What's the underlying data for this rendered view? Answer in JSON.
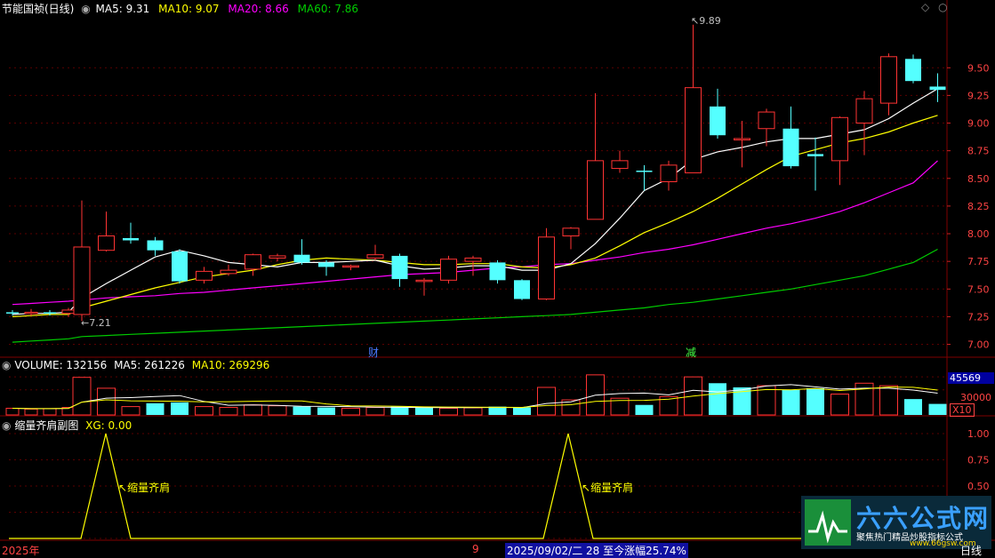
{
  "header": {
    "stock_title": "节能国祯(日线)",
    "ma5": "MA5: 9.31",
    "ma10": "MA10: 9.07",
    "ma20": "MA20: 8.66",
    "ma60": "MA60: 7.86"
  },
  "volume_header": {
    "volume": "VOLUME: 132156",
    "ma5": "MA5: 261226",
    "ma10": "MA10: 269296"
  },
  "sub_header": {
    "title": "缩量齐肩副图",
    "xg": "XG: 0.00"
  },
  "annotations": {
    "high": "9.89",
    "low": "7.21",
    "tag_cai": "财",
    "tag_jian": "减",
    "pattern1": "缩量齐肩",
    "pattern2": "缩量齐肩"
  },
  "vol_axis": {
    "top_value": "45569",
    "mid_value": "30000",
    "unit": "X10"
  },
  "footer": {
    "year": "2025年",
    "month": "9",
    "range_info": "2025/09/02/二 28 至今涨幅25.74%",
    "period": "日线"
  },
  "logo": {
    "name": "六六公式网",
    "slogan": "聚焦热门精品炒股指标公式",
    "url": "www.66gsw.com"
  },
  "colors": {
    "up": "#ff3333",
    "down": "#54ffff",
    "ma5": "#ffffff",
    "ma10": "#ffff00",
    "ma20": "#ff00ff",
    "ma60": "#00cc00",
    "grid": "#800000"
  },
  "chart_data": [
    {
      "type": "candlestick",
      "title": "节能国祯(日线)",
      "y_ticks": [
        7.0,
        7.25,
        7.5,
        7.75,
        8.0,
        8.25,
        8.5,
        8.75,
        9.0,
        9.25,
        9.5
      ],
      "ylim": [
        6.9,
        10.0
      ],
      "candles": [
        {
          "o": 7.29,
          "c": 7.28,
          "h": 7.31,
          "l": 7.26
        },
        {
          "o": 7.28,
          "c": 7.29,
          "h": 7.32,
          "l": 7.26
        },
        {
          "o": 7.29,
          "c": 7.28,
          "h": 7.31,
          "l": 7.26
        },
        {
          "o": 7.28,
          "c": 7.31,
          "h": 7.33,
          "l": 7.25
        },
        {
          "o": 7.27,
          "c": 7.88,
          "h": 8.3,
          "l": 7.21
        },
        {
          "o": 7.85,
          "c": 7.98,
          "h": 8.2,
          "l": 7.84
        },
        {
          "o": 7.96,
          "c": 7.94,
          "h": 8.1,
          "l": 7.91
        },
        {
          "o": 7.94,
          "c": 7.85,
          "h": 7.97,
          "l": 7.8
        },
        {
          "o": 7.84,
          "c": 7.57,
          "h": 7.86,
          "l": 7.55
        },
        {
          "o": 7.58,
          "c": 7.66,
          "h": 7.7,
          "l": 7.55
        },
        {
          "o": 7.64,
          "c": 7.67,
          "h": 7.72,
          "l": 7.62
        },
        {
          "o": 7.68,
          "c": 7.81,
          "h": 7.82,
          "l": 7.62
        },
        {
          "o": 7.78,
          "c": 7.8,
          "h": 7.82,
          "l": 7.75
        },
        {
          "o": 7.81,
          "c": 7.74,
          "h": 7.95,
          "l": 7.72
        },
        {
          "o": 7.74,
          "c": 7.7,
          "h": 7.76,
          "l": 7.62
        },
        {
          "o": 7.7,
          "c": 7.71,
          "h": 7.72,
          "l": 7.67
        },
        {
          "o": 7.78,
          "c": 7.81,
          "h": 7.9,
          "l": 7.76
        },
        {
          "o": 7.8,
          "c": 7.59,
          "h": 7.82,
          "l": 7.52
        },
        {
          "o": 7.58,
          "c": 7.58,
          "h": 7.6,
          "l": 7.44
        },
        {
          "o": 7.58,
          "c": 7.77,
          "h": 7.8,
          "l": 7.55
        },
        {
          "o": 7.75,
          "c": 7.78,
          "h": 7.8,
          "l": 7.62
        },
        {
          "o": 7.74,
          "c": 7.58,
          "h": 7.76,
          "l": 7.55
        },
        {
          "o": 7.58,
          "c": 7.41,
          "h": 7.59,
          "l": 7.4
        },
        {
          "o": 7.41,
          "c": 7.97,
          "h": 8.05,
          "l": 7.4
        },
        {
          "o": 7.98,
          "c": 8.05,
          "h": 8.06,
          "l": 7.86
        },
        {
          "o": 8.13,
          "c": 8.66,
          "h": 9.27,
          "l": 8.13
        },
        {
          "o": 8.59,
          "c": 8.66,
          "h": 8.75,
          "l": 8.55
        },
        {
          "o": 8.57,
          "c": 8.56,
          "h": 8.62,
          "l": 8.39
        },
        {
          "o": 8.47,
          "c": 8.62,
          "h": 8.66,
          "l": 8.39
        },
        {
          "o": 8.55,
          "c": 9.32,
          "h": 9.89,
          "l": 8.55
        },
        {
          "o": 9.15,
          "c": 8.89,
          "h": 9.31,
          "l": 8.86
        },
        {
          "o": 8.86,
          "c": 8.86,
          "h": 9.02,
          "l": 8.6
        },
        {
          "o": 8.95,
          "c": 9.1,
          "h": 9.13,
          "l": 8.79
        },
        {
          "o": 8.95,
          "c": 8.61,
          "h": 9.15,
          "l": 8.59
        },
        {
          "o": 8.72,
          "c": 8.7,
          "h": 8.87,
          "l": 8.39
        },
        {
          "o": 8.66,
          "c": 9.05,
          "h": 9.06,
          "l": 8.44
        },
        {
          "o": 9.0,
          "c": 9.22,
          "h": 9.29,
          "l": 8.71
        },
        {
          "o": 9.18,
          "c": 9.6,
          "h": 9.63,
          "l": 9.07
        },
        {
          "o": 9.58,
          "c": 9.38,
          "h": 9.62,
          "l": 9.36
        },
        {
          "o": 9.33,
          "c": 9.3,
          "h": 9.45,
          "l": 9.19
        }
      ],
      "ma5": [
        7.27,
        7.28,
        7.28,
        7.29,
        7.42,
        7.55,
        7.67,
        7.79,
        7.85,
        7.8,
        7.74,
        7.72,
        7.7,
        7.74,
        7.74,
        7.75,
        7.76,
        7.71,
        7.68,
        7.69,
        7.71,
        7.71,
        7.67,
        7.67,
        7.73,
        7.91,
        8.14,
        8.39,
        8.5,
        8.67,
        8.74,
        8.78,
        8.83,
        8.86,
        8.86,
        8.9,
        8.94,
        9.04,
        9.18,
        9.31
      ],
      "ma10": [
        7.25,
        7.26,
        7.27,
        7.27,
        7.33,
        7.39,
        7.45,
        7.51,
        7.56,
        7.61,
        7.64,
        7.67,
        7.72,
        7.76,
        7.78,
        7.77,
        7.76,
        7.74,
        7.72,
        7.72,
        7.73,
        7.73,
        7.7,
        7.69,
        7.72,
        7.78,
        7.89,
        8.01,
        8.1,
        8.2,
        8.32,
        8.45,
        8.58,
        8.7,
        8.76,
        8.82,
        8.86,
        8.92,
        9.0,
        9.07
      ],
      "ma20": [
        7.36,
        7.37,
        7.38,
        7.39,
        7.4,
        7.42,
        7.43,
        7.44,
        7.46,
        7.47,
        7.49,
        7.51,
        7.53,
        7.55,
        7.57,
        7.59,
        7.61,
        7.63,
        7.64,
        7.65,
        7.67,
        7.69,
        7.7,
        7.72,
        7.73,
        7.76,
        7.79,
        7.83,
        7.86,
        7.9,
        7.95,
        8.0,
        8.05,
        8.09,
        8.14,
        8.2,
        8.28,
        8.37,
        8.46,
        8.66
      ],
      "ma60": [
        7.02,
        7.03,
        7.04,
        7.05,
        7.07,
        7.08,
        7.09,
        7.1,
        7.11,
        7.12,
        7.13,
        7.14,
        7.15,
        7.16,
        7.17,
        7.18,
        7.19,
        7.2,
        7.21,
        7.22,
        7.23,
        7.24,
        7.25,
        7.26,
        7.27,
        7.29,
        7.31,
        7.33,
        7.36,
        7.38,
        7.41,
        7.44,
        7.47,
        7.5,
        7.54,
        7.58,
        7.62,
        7.68,
        7.74,
        7.86
      ]
    },
    {
      "type": "bar",
      "title": "VOLUME",
      "values": [
        8000,
        7000,
        7500,
        9000,
        45000,
        32000,
        10000,
        14000,
        15000,
        10000,
        9000,
        12000,
        11000,
        10000,
        9000,
        8000,
        9000,
        10000,
        8500,
        8000,
        8500,
        10000,
        9000,
        33000,
        18000,
        48000,
        20000,
        12000,
        22000,
        45569,
        38000,
        33000,
        35000,
        30000,
        32000,
        25000,
        38000,
        35000,
        19000,
        13216
      ],
      "up": [
        true,
        true,
        true,
        true,
        true,
        true,
        true,
        false,
        false,
        true,
        true,
        true,
        true,
        false,
        false,
        true,
        true,
        false,
        false,
        true,
        true,
        false,
        false,
        true,
        true,
        true,
        true,
        false,
        true,
        true,
        false,
        false,
        true,
        false,
        false,
        true,
        true,
        true,
        false,
        false
      ]
    },
    {
      "type": "line",
      "title": "缩量齐肩副图",
      "y_ticks": [
        1.0,
        0.75,
        0.5,
        0.25,
        0.0
      ],
      "peaks_at_index": [
        4,
        23
      ]
    }
  ]
}
